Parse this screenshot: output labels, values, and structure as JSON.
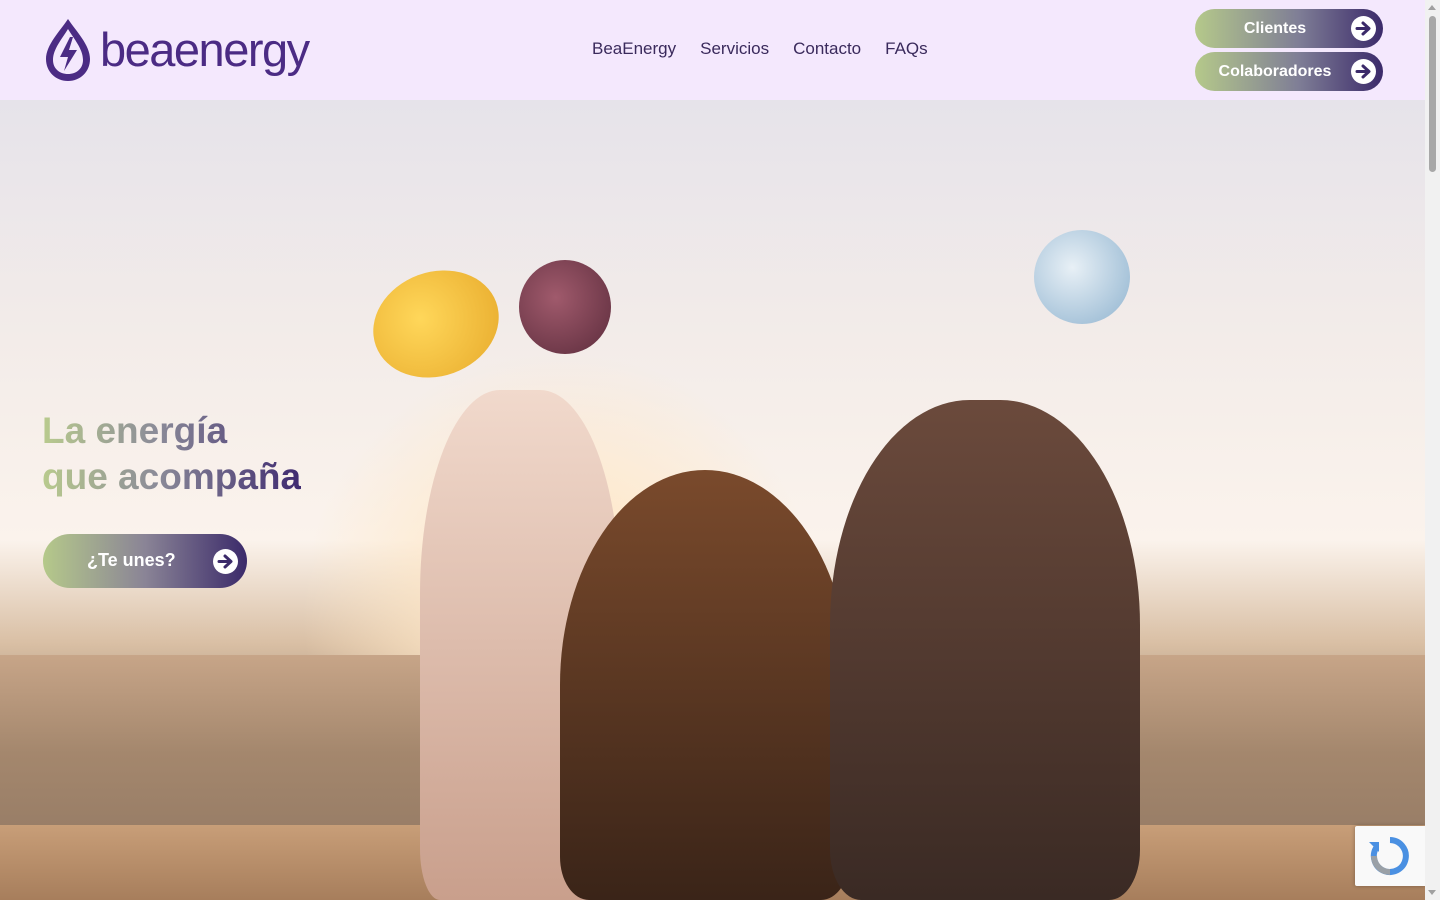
{
  "header": {
    "logo_text": "beaenergy",
    "nav": [
      "BeaEnergy",
      "Servicios",
      "Contacto",
      "FAQs"
    ],
    "buttons": {
      "clients": "Clientes",
      "collaborators": "Colaboradores"
    }
  },
  "hero": {
    "title_line1": "La energía",
    "title_line2": "que acompaña",
    "cta": "¿Te unes?"
  },
  "icons": {
    "logo": "drop-bolt-icon",
    "arrow": "arrow-right-circle-icon",
    "captcha": "recaptcha-icon"
  },
  "colors": {
    "brand_purple": "#4b2b84",
    "brand_green": "#b5c98a",
    "header_bg": "#f4e8fd"
  }
}
